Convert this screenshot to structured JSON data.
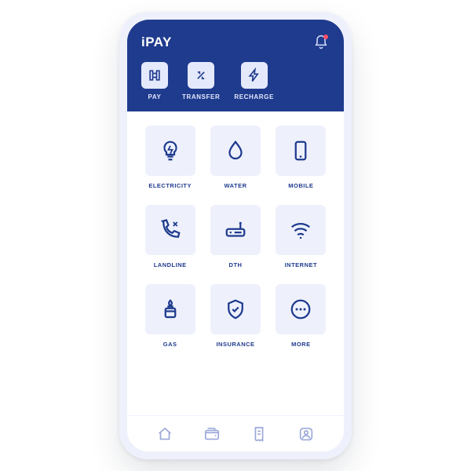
{
  "app": {
    "title": "iPAY"
  },
  "header_actions": [
    {
      "label": "PAY"
    },
    {
      "label": "TRANSFER"
    },
    {
      "label": "RECHARGE"
    }
  ],
  "categories": [
    {
      "label": "ELECTRICITY"
    },
    {
      "label": "WATER"
    },
    {
      "label": "MOBILE"
    },
    {
      "label": "LANDLINE"
    },
    {
      "label": "DTH"
    },
    {
      "label": "INTERNET"
    },
    {
      "label": "GAS"
    },
    {
      "label": "INSURANCE"
    },
    {
      "label": "MORE"
    }
  ],
  "nav": {
    "home": "home",
    "wallet": "wallet",
    "receipt": "receipt",
    "profile": "profile"
  },
  "colors": {
    "brand": "#1f3b8e",
    "tile_bg": "#eef1fc",
    "notification_dot": "#ff4d63"
  }
}
